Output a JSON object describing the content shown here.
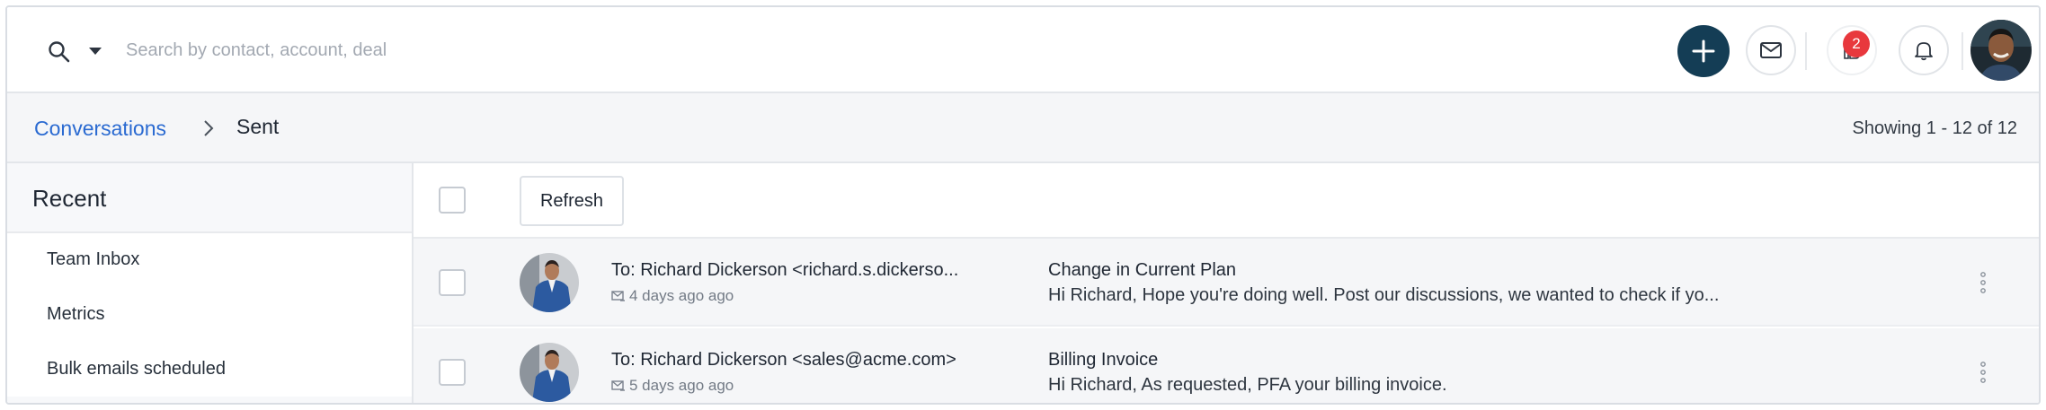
{
  "search": {
    "placeholder": "Search by contact, account, deal"
  },
  "header": {
    "notification_count": "2"
  },
  "breadcrumb": {
    "parent": "Conversations",
    "current": "Sent"
  },
  "pagination": {
    "showing": "Showing 1 - 12 of 12"
  },
  "sidebar": {
    "title": "Recent",
    "items": [
      {
        "label": "Team Inbox"
      },
      {
        "label": "Metrics"
      },
      {
        "label": "Bulk emails scheduled"
      }
    ]
  },
  "toolbar": {
    "refresh_label": "Refresh"
  },
  "emails": [
    {
      "to": "To: Richard Dickerson <richard.s.dickerso...",
      "time": "4 days ago ago",
      "subject": "Change in Current Plan",
      "preview": "Hi Richard, Hope you're doing well. Post our discussions, we wanted to check if yo..."
    },
    {
      "to": "To: Richard Dickerson <sales@acme.com>",
      "time": "5 days ago ago",
      "subject": "Billing Invoice",
      "preview": "Hi Richard, As requested, PFA your billing invoice."
    }
  ],
  "colors": {
    "accent_link": "#2a6ad1",
    "add_button": "#143d55",
    "badge": "#e8383d"
  },
  "icons": {
    "search": "search-icon",
    "add": "plus-icon",
    "mail": "mail-icon",
    "thanks": "thanks-icon",
    "bell": "bell-icon"
  }
}
